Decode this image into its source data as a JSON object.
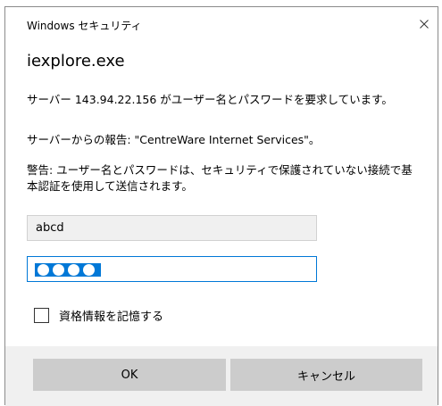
{
  "window": {
    "title": "Windows セキュリティ",
    "close_icon": "close-icon"
  },
  "app_name": "iexplore.exe",
  "messages": {
    "request": "サーバー 143.94.22.156 がユーザー名とパスワードを要求しています。",
    "report": "サーバーからの報告: \"CentreWare Internet Services\"。",
    "warning": "警告: ユーザー名とパスワードは、セキュリティで保護されていない接続で基本認証を使用して送信されます。"
  },
  "fields": {
    "username_value": "abcd",
    "password_masked_length": 4
  },
  "remember": {
    "label": "資格情報を記憶する",
    "checked": false
  },
  "buttons": {
    "ok": "OK",
    "cancel": "キャンセル"
  },
  "colors": {
    "accent": "#0078d7",
    "button_bg": "#cccccc",
    "footer_bg": "#f0f0f0"
  }
}
